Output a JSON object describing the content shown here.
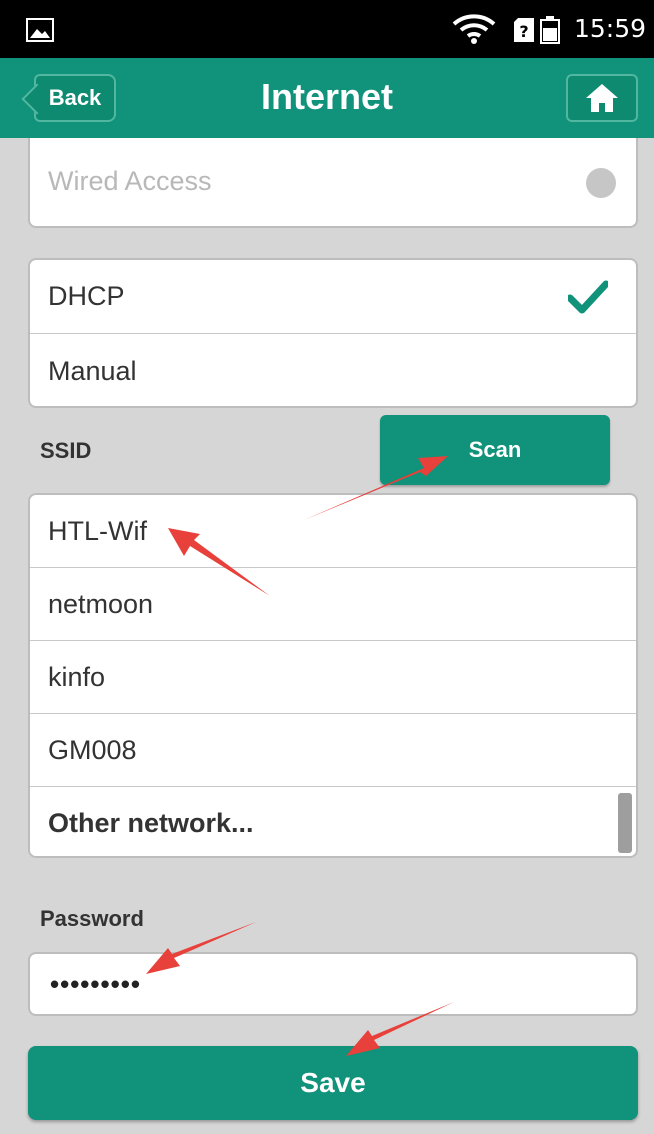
{
  "status_bar": {
    "time": "15:59",
    "icons": [
      "image-icon",
      "wifi-icon",
      "sim-icon",
      "battery-icon"
    ]
  },
  "header": {
    "back_label": "Back",
    "title": "Internet",
    "home_icon": "home-icon"
  },
  "wired": {
    "label": "Wired Access"
  },
  "ip_mode": {
    "options": [
      "DHCP",
      "Manual"
    ],
    "selected": "DHCP"
  },
  "ssid": {
    "label": "SSID",
    "scan_label": "Scan",
    "networks": [
      "HTL-Wif",
      "netmoon",
      "kinfo",
      "GM008"
    ],
    "other_label": "Other network..."
  },
  "password": {
    "label": "Password",
    "value": "•••••••••"
  },
  "save_label": "Save",
  "colors": {
    "accent": "#11927a",
    "background": "#d6d6d6",
    "annotation_arrow": "#e8403a"
  }
}
